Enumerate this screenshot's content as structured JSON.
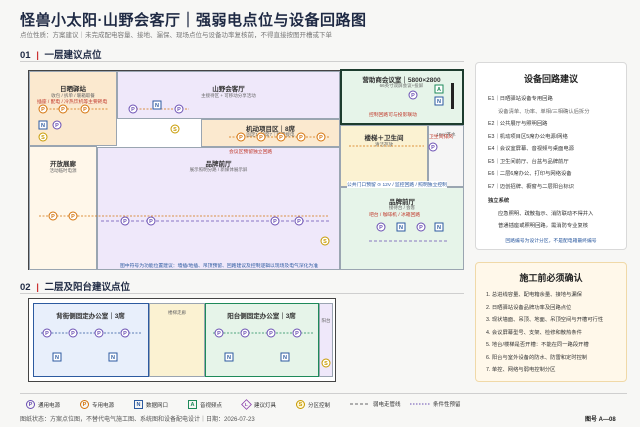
{
  "header": {
    "title": "怪兽小太阳·山野会客厅｜强弱电点位与设备回路图",
    "subtitle": "点位性质：方案建议｜未完成配电容量、接地、漏保、现场点位与设备功率复核前，不得直接按图开槽或下单"
  },
  "floor1": {
    "heading_num": "01",
    "heading": "一层建议点位",
    "rooms": {
      "sunroom": {
        "name": "日晒驿站",
        "note": "收包 / 拆单 / 暖箱取餐"
      },
      "lounge": {
        "name": "山野会客厅",
        "note": "主接待区 + 可移动分享活动"
      },
      "office": {
        "name": "营助商会议室｜5800×2800",
        "note": "66英寸双屏会议+投屏"
      },
      "project": {
        "name": "机动项目区｜8席",
        "note": "固定1+加席7｜按需接电"
      },
      "stock": {
        "name": "楼梯＋卫生间",
        "note": "清洁存放"
      },
      "open": {
        "name": "开放展廊",
        "note": "活动临时电源"
      },
      "brand": {
        "name": "品牌前厅",
        "note": "展示照明分路 / 新媒体展示屏"
      },
      "brand2": {
        "name": "品牌前厅",
        "note": "接待台 / 会客"
      },
      "smallroom": {
        "name": "18m²茶水",
        "note": ""
      }
    },
    "annotations": {
      "sun_red": "插座 / 配电 / 冷热饮机等主要耗电",
      "office_red": "控制回路可与投影联动",
      "project_red": "会议区预留独立回路",
      "bottom_blue": "图中符号为功能位置建议：墙插/地插、吊顶预留、回路建议及控制逻辑以现场及电气深化为准",
      "stock_red": "卫生间排风",
      "brand2_red": "吧台 / 咖啡机 / 冰箱回路",
      "circuit_note": "公共门口预留 ⊙ 12V / 监控回路 / 照明独立控制"
    }
  },
  "floor2": {
    "heading_num": "02",
    "heading": "二层及阳台建议点位",
    "rooms": {
      "back": {
        "name": "背街侧固定办公室｜3席",
        "note": ""
      },
      "stair": {
        "name": "楼梯走廊",
        "note": ""
      },
      "balcony": {
        "name": "阳台侧固定办公室｜3席",
        "note": ""
      },
      "terrace": {
        "name": "阳台",
        "note": ""
      }
    }
  },
  "circuits_panel": {
    "title": "设备回路建议",
    "items": [
      "E1｜日晒驿站设备专用回路",
      "设备清单、功率、单相/三相确认后拆分",
      "E2｜公共展厅与照明回路",
      "E3｜机动项目区5席办公电源/网络",
      "E4｜会议室屏幕、音视频与桌面电源",
      "E5｜卫生间前厅、台盆与品牌前厅",
      "E6｜二层6席办公、打印与网络设备",
      "E7｜迈创招牌、橱窗与二层阳台标识"
    ],
    "sub_title": "独立系统",
    "sub_items": [
      "应急照明、疏散指示、消防联动不得并入",
      "普通插座或照明回路，需消防专业复核"
    ],
    "note": "回路编号为设计分区，不是配电箱最终编号"
  },
  "checklist_panel": {
    "title": "施工前必须确认",
    "items": [
      "1. 总进线容量、配电箱余量、接地与漏保",
      "2. 日晒驿站设备品牌功率及回路点位",
      "3. 现状墙面、吊顶、地面、吊顶空间与开槽可行性",
      "4. 会议屏幕型号、支架、检修和散热条件",
      "5. 地台/楼梯是否开槽：不能在同一路段开槽",
      "6. 阳台与室外设备的防水、防雷和定时控制",
      "7. 单控、网络与弱电控制分区"
    ]
  },
  "legend": {
    "items": [
      {
        "sym": "P",
        "label": "通用电源",
        "color": "#6a4fb3",
        "shape": "circle"
      },
      {
        "sym": "P",
        "label": "专用电源",
        "color": "#d4730b",
        "shape": "circle"
      },
      {
        "sym": "N",
        "label": "数据网口",
        "color": "#2c5aa0",
        "shape": "square"
      },
      {
        "sym": "A",
        "label": "音视频点",
        "color": "#1e8a5a",
        "shape": "square"
      },
      {
        "sym": "L",
        "label": "建议灯具",
        "color": "#8e44ad",
        "shape": "diamond"
      },
      {
        "sym": "S",
        "label": "分区控制",
        "color": "#c79a00",
        "shape": "circle"
      }
    ],
    "line1": "弱电走管线",
    "line2": "条件性预留"
  },
  "footer": {
    "status": "图纸状态：方案点位图，不替代电气施工图、系统图和设备配电设计｜日期：2026-07-23",
    "code": "图号 A—08"
  }
}
